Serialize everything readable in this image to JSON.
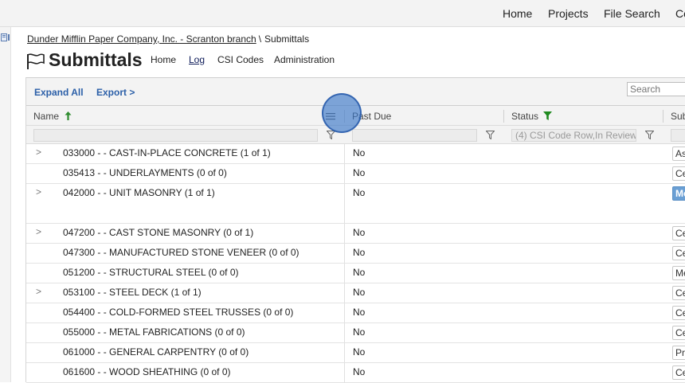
{
  "topnav": {
    "items": [
      {
        "label": "Home"
      },
      {
        "label": "Projects"
      },
      {
        "label": "File Search"
      },
      {
        "label": "Co"
      }
    ]
  },
  "breadcrumb": {
    "link": "Dunder Mifflin Paper Company, Inc. - Scranton branch",
    "separator": "\\",
    "current": "Submittals"
  },
  "page": {
    "title": "Submittals",
    "subnav": [
      {
        "label": "Home"
      },
      {
        "label": "Log",
        "active": true
      },
      {
        "label": "CSI Codes"
      },
      {
        "label": "Administration"
      }
    ]
  },
  "toolbar": {
    "expand_all": "Expand All",
    "export": "Export >",
    "search_placeholder": "Search"
  },
  "columns": {
    "name": "Name",
    "past_due": "Past Due",
    "status": "Status",
    "sub": "Sub"
  },
  "filters": {
    "status_value": "(4) CSI Code Row,In Review"
  },
  "rows": [
    {
      "name": "033000 - - CAST-IN-PLACE CONCRETE (1 of 1)",
      "past_due": "No",
      "expandable": true,
      "sub": "As"
    },
    {
      "name": "035413 - - UNDERLAYMENTS (0 of 0)",
      "past_due": "No",
      "expandable": false,
      "sub": "Ce"
    },
    {
      "name": "042000 - - UNIT MASONRY (1 of 1)",
      "past_due": "No",
      "expandable": true,
      "sub": "Mo"
    },
    {
      "name": "047200 - - CAST STONE MASONRY (0 of 1)",
      "past_due": "No",
      "expandable": true,
      "sub": "Ce"
    },
    {
      "name": "047300 - - MANUFACTURED STONE VENEER (0 of 0)",
      "past_due": "No",
      "expandable": false,
      "sub": "Ce"
    },
    {
      "name": "051200 - - STRUCTURAL STEEL (0 of 0)",
      "past_due": "No",
      "expandable": false,
      "sub": "Me"
    },
    {
      "name": "053100 - - STEEL DECK (1 of 1)",
      "past_due": "No",
      "expandable": true,
      "sub": "Ce"
    },
    {
      "name": "054400 - - COLD-FORMED STEEL TRUSSES (0 of 0)",
      "past_due": "No",
      "expandable": false,
      "sub": "Ce"
    },
    {
      "name": "055000 - - METAL FABRICATIONS (0 of 0)",
      "past_due": "No",
      "expandable": false,
      "sub": "Ce"
    },
    {
      "name": "061000 - - GENERAL CARPENTRY (0 of 0)",
      "past_due": "No",
      "expandable": false,
      "sub": "Pro"
    },
    {
      "name": "061600 - - WOOD SHEATHING (0 of 0)",
      "past_due": "No",
      "expandable": false,
      "sub": "Ce"
    }
  ],
  "colors": {
    "link_blue": "#2b5fa8",
    "sort_arrow_green": "#2e8b2e",
    "filter_green": "#1f8a1f",
    "highlight_blue": "#6a9fd4"
  }
}
